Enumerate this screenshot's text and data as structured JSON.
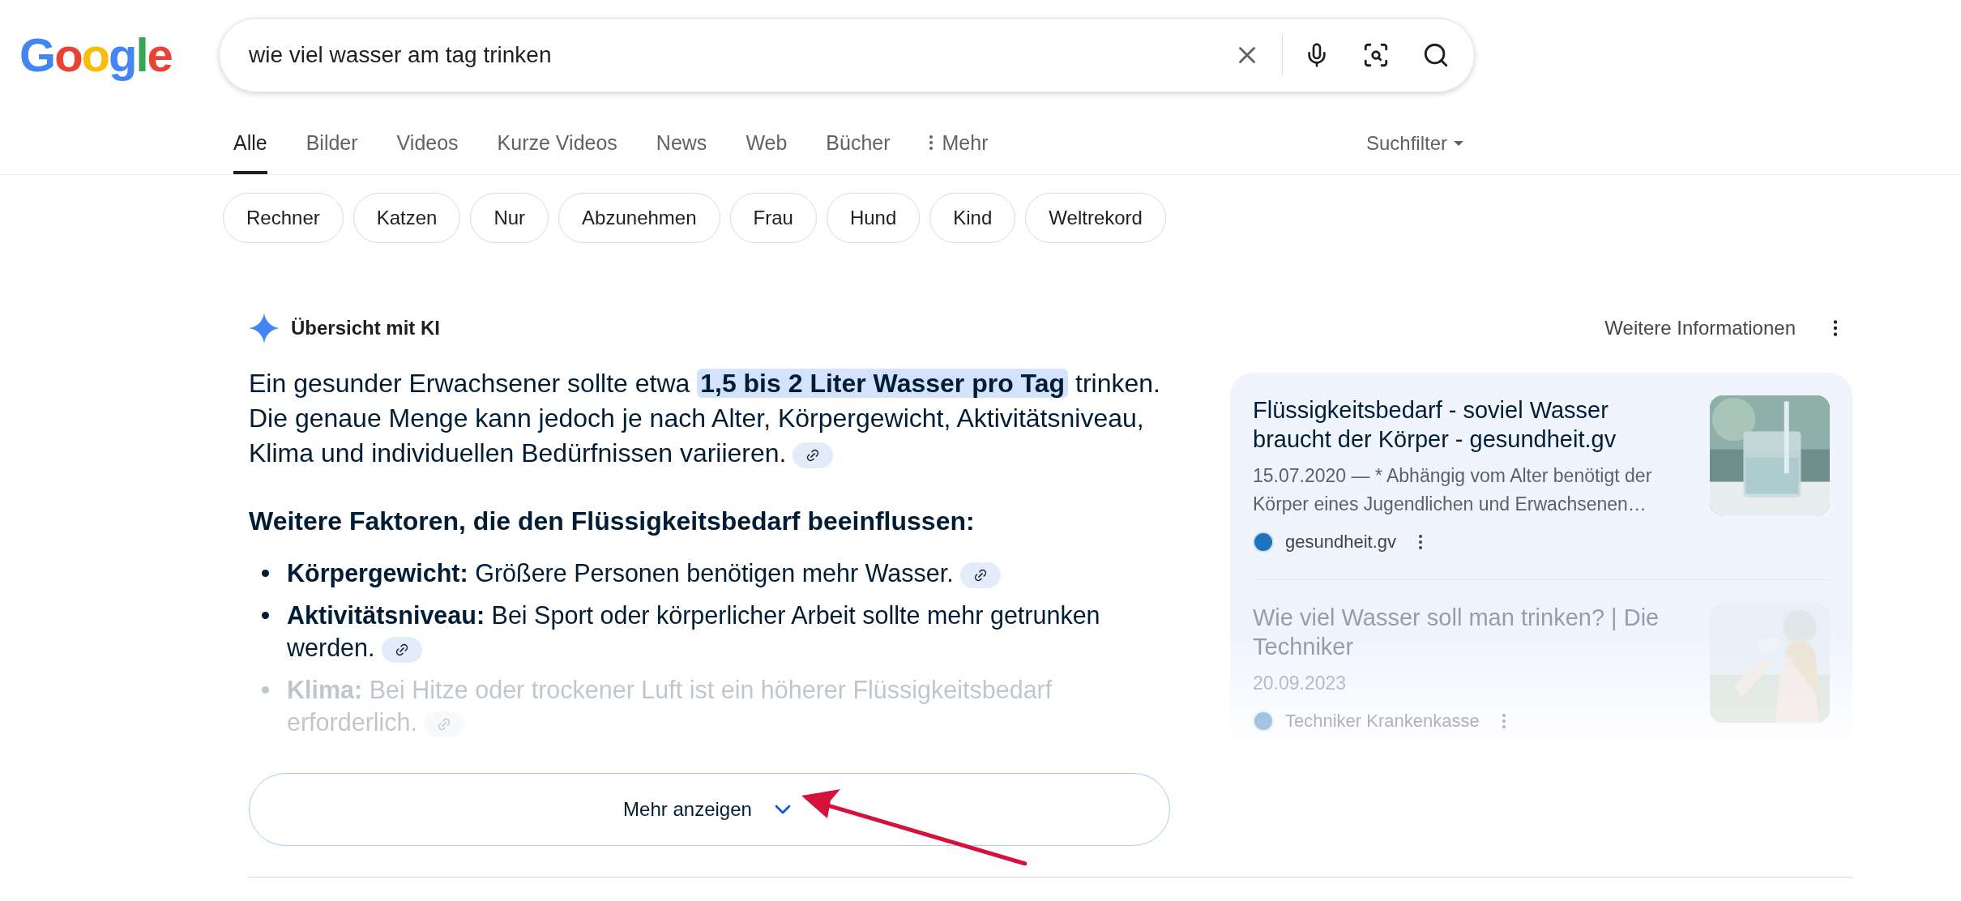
{
  "logo": "Google",
  "search": {
    "value": "wie viel wasser am tag trinken"
  },
  "tabs": [
    {
      "label": "Alle",
      "selected": true
    },
    {
      "label": "Bilder",
      "selected": false
    },
    {
      "label": "Videos",
      "selected": false
    },
    {
      "label": "Kurze Videos",
      "selected": false
    },
    {
      "label": "News",
      "selected": false
    },
    {
      "label": "Web",
      "selected": false
    },
    {
      "label": "Bücher",
      "selected": false
    },
    {
      "label": "Mehr",
      "selected": false,
      "kind": "more"
    }
  ],
  "filter": "Suchfilter",
  "chips": [
    "Rechner",
    "Katzen",
    "Nur",
    "Abzunehmen",
    "Frau",
    "Hund",
    "Kind",
    "Weltrekord"
  ],
  "ai_overview": {
    "title": "Übersicht mit KI",
    "more_info": "Weitere Informationen",
    "intro": [
      {
        "text": "Ein gesunder Erwachsener sollte etwa ",
        "highlighted": false
      },
      {
        "text": "1,5 bis 2 Liter Wasser pro Tag",
        "highlighted": true
      },
      {
        "text": " trinken. Die genaue Menge kann jedoch je nach Alter, Körpergewicht, Aktivitätsniveau, Klima und individuellen Bedürfnissen variieren.",
        "highlighted": false
      }
    ],
    "heading": "Weitere Faktoren, die den Flüssigkeitsbedarf beeinflussen:",
    "bullets": [
      {
        "text": "**Körpergewicht:** Größere Personen benötigen mehr Wasser.",
        "faded": false
      },
      {
        "text": "**Aktivitätsniveau:** Bei Sport oder körperlicher Arbeit sollte mehr getrunken werden.",
        "faded": false
      },
      {
        "text": "**Klima:** Bei Hitze oder trockener Luft ist ein höherer Flüssigkeitsbedarf erforderlich.",
        "faded": true
      }
    ],
    "show_more": "Mehr anzeigen",
    "sources": [
      {
        "title": "Flüssigkeitsbedarf - soviel Wasser braucht der Körper - gesundheit.gv",
        "snippet": "15.07.2020 — * Abhängig vom Alter benötigt der Körper eines Jugendlichen und Erwachsenen…",
        "site": "gesundheit.gv",
        "faded": false,
        "kind": "picture"
      },
      {
        "title": "Wie viel Wasser soll man trinken? | Die Techniker",
        "snippet": "20.09.2023",
        "site": "Techniker Krankenkasse",
        "faded": true,
        "kind": "picture"
      }
    ]
  }
}
